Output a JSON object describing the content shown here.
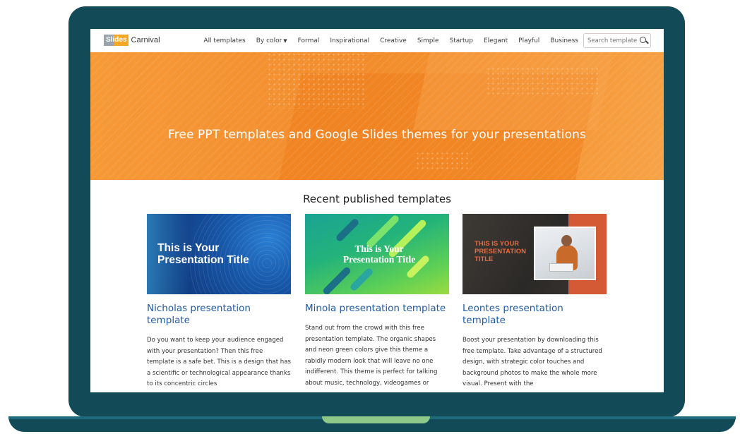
{
  "logo": {
    "part1": "Slides",
    "part2": "Carnival"
  },
  "nav": {
    "items": [
      "All templates",
      "By color",
      "Formal",
      "Inspirational",
      "Creative",
      "Simple",
      "Startup",
      "Elegant",
      "Playful",
      "Business"
    ],
    "search_placeholder": "Search template"
  },
  "hero": {
    "title": "Free PPT templates and Google Slides themes for your presentations"
  },
  "section": {
    "title": "Recent published templates"
  },
  "cards": [
    {
      "thumb_text": "This is Your Presentation Title",
      "title": "Nicholas presentation template",
      "desc": "Do you want to keep your audience engaged with your presentation? Then this free template is a safe bet. This is a design that has a scientific or technological appearance thanks to its concentric circles"
    },
    {
      "thumb_text": "This is Your Presentation Title",
      "title": "Minola presentation template",
      "desc": "Stand out from the crowd with this free presentation template. The organic shapes and neon green colors give this theme a rabidly modern look that will leave no one indifferent. This theme is perfect for talking about music, technology, videogames or"
    },
    {
      "thumb_text": "THIS IS YOUR PRESENTATION TITLE",
      "title": "Leontes presentation template",
      "desc": "Boost your presentation by downloading this free template. Take advantage of a structured design, with strategic color touches and background photos to make the whole more visual. Present with the"
    }
  ],
  "colors": {
    "accent": "#f28c2c",
    "link": "#1f5aa6",
    "frame": "#134a57"
  }
}
